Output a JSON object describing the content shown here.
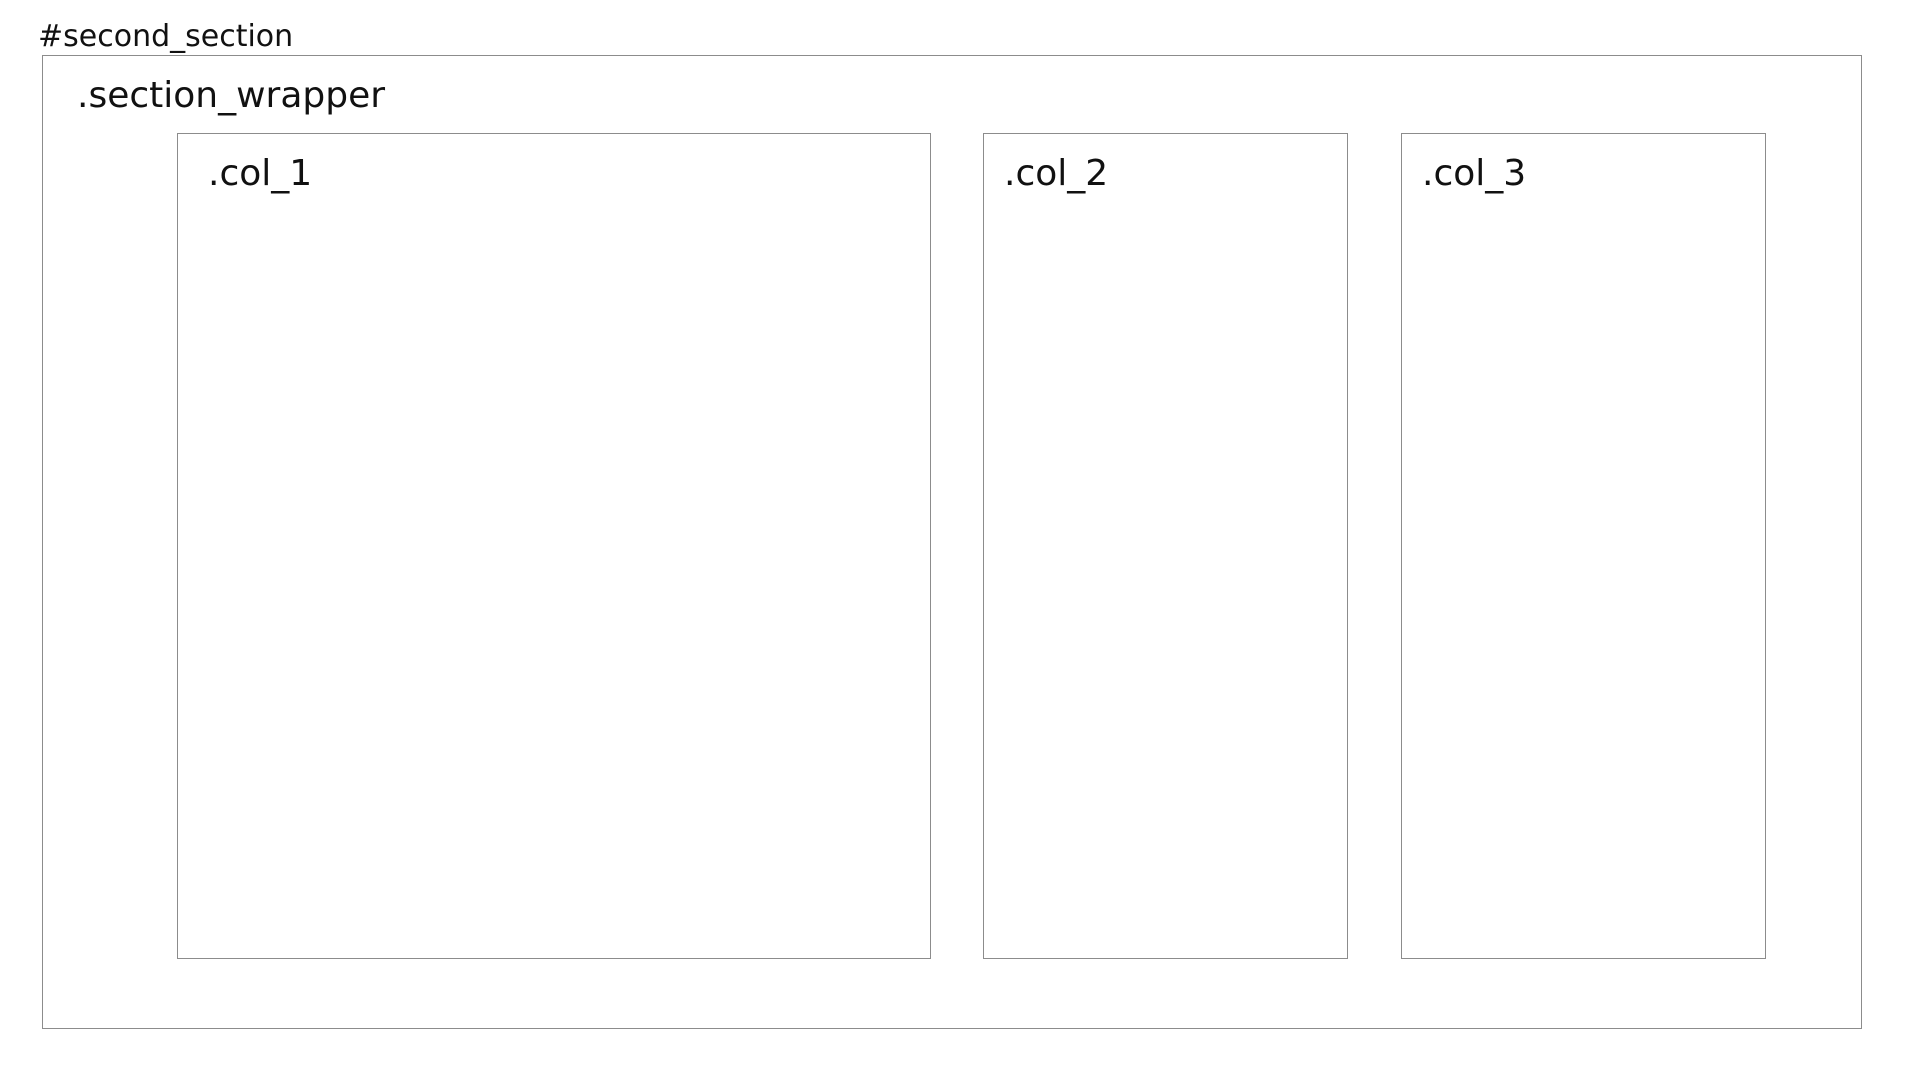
{
  "section": {
    "id_label": "#second_section"
  },
  "wrapper": {
    "class_label": ".section_wrapper"
  },
  "columns": [
    {
      "class_label": ".col_1"
    },
    {
      "class_label": ".col_2"
    },
    {
      "class_label": ".col_3"
    }
  ]
}
